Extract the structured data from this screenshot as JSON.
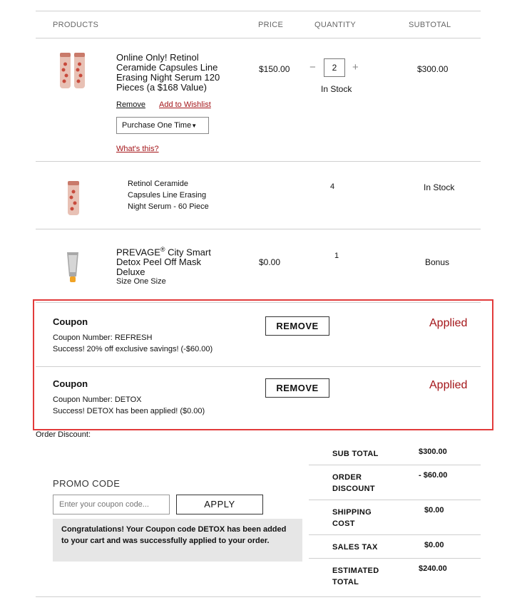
{
  "table_headers": {
    "products": "PRODUCTS",
    "price": "PRICE",
    "quantity": "QUANTITY",
    "subtotal": "SUBTOTAL"
  },
  "items": [
    {
      "name": "Online Only! Retinol Ceramide Capsules Line Erasing Night Serum 120 Pieces (a $168 Value)",
      "name_lines": [
        "Online Only! Retinol",
        "Ceramide Capsules Line",
        "Erasing Night Serum 120",
        "Pieces (a $168 Value)"
      ],
      "price": "$150.00",
      "quantity": "2",
      "qty_minus": "−",
      "qty_plus": "+",
      "stock": "In Stock",
      "subtotal": "$300.00",
      "remove_label": "Remove",
      "wishlist_label": "Add to Wishlist",
      "purchase_option": "Purchase One Time",
      "whats_this": "What's this?"
    },
    {
      "name_lines": [
        "Retinol Ceramide",
        "Capsules Line Erasing",
        "Night Serum - 60 Piece"
      ],
      "quantity": "4",
      "stock": "In Stock"
    },
    {
      "name_main": "PREVAGE",
      "name_sup": "®",
      "name_rest": " City Smart",
      "name_lines": [
        "Detox Peel Off Mask",
        "Deluxe"
      ],
      "size": "Size One Size",
      "price": "$0.00",
      "quantity": "1",
      "subtotal": "Bonus"
    }
  ],
  "coupons": [
    {
      "title": "Coupon",
      "number": "Coupon Number: REFRESH",
      "message": "Success! 20% off exclusive savings! (-$60.00)",
      "remove_label": "REMOVE",
      "status": "Applied"
    },
    {
      "title": "Coupon",
      "number": "Coupon Number: DETOX",
      "message": "Success! DETOX has been applied! ($0.00)",
      "remove_label": "REMOVE",
      "status": "Applied"
    }
  ],
  "order_discount_label": "Order Discount:",
  "promo": {
    "heading": "PROMO CODE",
    "placeholder": "Enter your coupon code...",
    "apply_label": "APPLY",
    "congrats": "Congratulations! Your Coupon code DETOX has been added to your cart and was successfully applied to your order."
  },
  "summary": [
    {
      "label_lines": [
        "SUB TOTAL"
      ],
      "value": "$300.00"
    },
    {
      "label_lines": [
        "ORDER",
        "DISCOUNT"
      ],
      "value": "- $60.00"
    },
    {
      "label_lines": [
        "SHIPPING",
        "COST"
      ],
      "value": "$0.00"
    },
    {
      "label_lines": [
        "SALES TAX"
      ],
      "value": "$0.00"
    },
    {
      "label_lines": [
        "ESTIMATED",
        "TOTAL"
      ],
      "value": "$240.00"
    }
  ],
  "colors": {
    "accent_red": "#a4161a",
    "highlight_border": "#e23b3b",
    "congrats_bg": "#e6e6e6"
  }
}
